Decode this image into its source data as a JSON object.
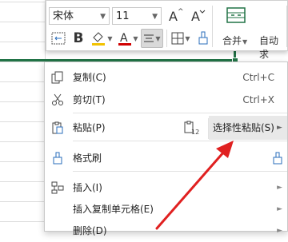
{
  "mini_toolbar": {
    "font_name": "宋体",
    "font_size": "11",
    "merge_label": "合并",
    "autofit_label": "自动求",
    "icons": [
      "increase-font-icon",
      "decrease-font-icon",
      "wrap-icon",
      "bold-icon",
      "fill-color-icon",
      "font-color-icon",
      "align-center-icon",
      "border-icon",
      "format-painter-icon",
      "merge-cells-icon"
    ]
  },
  "context_menu": {
    "copy": {
      "label": "复制(C)",
      "shortcut": "Ctrl+C"
    },
    "cut": {
      "label": "剪切(T)",
      "shortcut": "Ctrl+X"
    },
    "paste": {
      "label": "粘贴(P)"
    },
    "paste_special": {
      "label": "选择性粘贴(S)"
    },
    "format_painter": {
      "label": "格式刷"
    },
    "insert": {
      "label": "插入(I)"
    },
    "insert_copied": {
      "label": "插入复制单元格(E)"
    },
    "delete": {
      "label": "删除(D)"
    }
  },
  "colors": {
    "accent_green": "#217346",
    "annotation_arrow": "#e02020",
    "font_color": "#d00000",
    "fill_color": "#f2c200"
  }
}
